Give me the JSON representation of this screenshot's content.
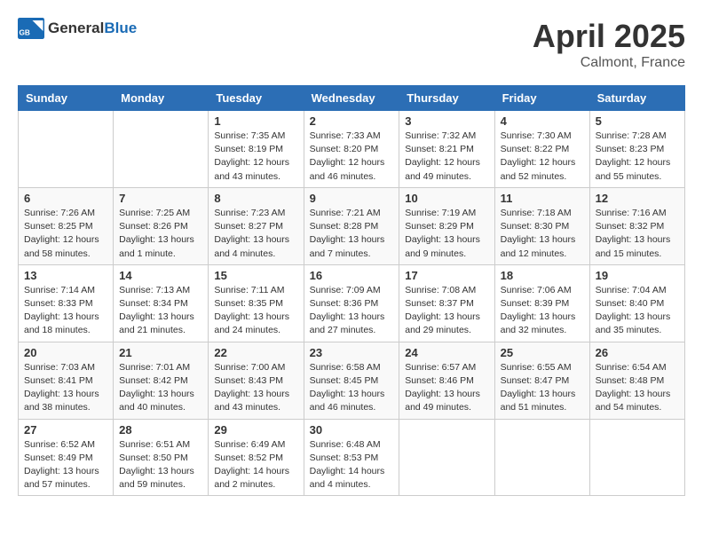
{
  "header": {
    "logo_general": "General",
    "logo_blue": "Blue",
    "title": "April 2025",
    "location": "Calmont, France"
  },
  "days_of_week": [
    "Sunday",
    "Monday",
    "Tuesday",
    "Wednesday",
    "Thursday",
    "Friday",
    "Saturday"
  ],
  "weeks": [
    [
      {
        "day": "",
        "info": ""
      },
      {
        "day": "",
        "info": ""
      },
      {
        "day": "1",
        "info": "Sunrise: 7:35 AM\nSunset: 8:19 PM\nDaylight: 12 hours and 43 minutes."
      },
      {
        "day": "2",
        "info": "Sunrise: 7:33 AM\nSunset: 8:20 PM\nDaylight: 12 hours and 46 minutes."
      },
      {
        "day": "3",
        "info": "Sunrise: 7:32 AM\nSunset: 8:21 PM\nDaylight: 12 hours and 49 minutes."
      },
      {
        "day": "4",
        "info": "Sunrise: 7:30 AM\nSunset: 8:22 PM\nDaylight: 12 hours and 52 minutes."
      },
      {
        "day": "5",
        "info": "Sunrise: 7:28 AM\nSunset: 8:23 PM\nDaylight: 12 hours and 55 minutes."
      }
    ],
    [
      {
        "day": "6",
        "info": "Sunrise: 7:26 AM\nSunset: 8:25 PM\nDaylight: 12 hours and 58 minutes."
      },
      {
        "day": "7",
        "info": "Sunrise: 7:25 AM\nSunset: 8:26 PM\nDaylight: 13 hours and 1 minute."
      },
      {
        "day": "8",
        "info": "Sunrise: 7:23 AM\nSunset: 8:27 PM\nDaylight: 13 hours and 4 minutes."
      },
      {
        "day": "9",
        "info": "Sunrise: 7:21 AM\nSunset: 8:28 PM\nDaylight: 13 hours and 7 minutes."
      },
      {
        "day": "10",
        "info": "Sunrise: 7:19 AM\nSunset: 8:29 PM\nDaylight: 13 hours and 9 minutes."
      },
      {
        "day": "11",
        "info": "Sunrise: 7:18 AM\nSunset: 8:30 PM\nDaylight: 13 hours and 12 minutes."
      },
      {
        "day": "12",
        "info": "Sunrise: 7:16 AM\nSunset: 8:32 PM\nDaylight: 13 hours and 15 minutes."
      }
    ],
    [
      {
        "day": "13",
        "info": "Sunrise: 7:14 AM\nSunset: 8:33 PM\nDaylight: 13 hours and 18 minutes."
      },
      {
        "day": "14",
        "info": "Sunrise: 7:13 AM\nSunset: 8:34 PM\nDaylight: 13 hours and 21 minutes."
      },
      {
        "day": "15",
        "info": "Sunrise: 7:11 AM\nSunset: 8:35 PM\nDaylight: 13 hours and 24 minutes."
      },
      {
        "day": "16",
        "info": "Sunrise: 7:09 AM\nSunset: 8:36 PM\nDaylight: 13 hours and 27 minutes."
      },
      {
        "day": "17",
        "info": "Sunrise: 7:08 AM\nSunset: 8:37 PM\nDaylight: 13 hours and 29 minutes."
      },
      {
        "day": "18",
        "info": "Sunrise: 7:06 AM\nSunset: 8:39 PM\nDaylight: 13 hours and 32 minutes."
      },
      {
        "day": "19",
        "info": "Sunrise: 7:04 AM\nSunset: 8:40 PM\nDaylight: 13 hours and 35 minutes."
      }
    ],
    [
      {
        "day": "20",
        "info": "Sunrise: 7:03 AM\nSunset: 8:41 PM\nDaylight: 13 hours and 38 minutes."
      },
      {
        "day": "21",
        "info": "Sunrise: 7:01 AM\nSunset: 8:42 PM\nDaylight: 13 hours and 40 minutes."
      },
      {
        "day": "22",
        "info": "Sunrise: 7:00 AM\nSunset: 8:43 PM\nDaylight: 13 hours and 43 minutes."
      },
      {
        "day": "23",
        "info": "Sunrise: 6:58 AM\nSunset: 8:45 PM\nDaylight: 13 hours and 46 minutes."
      },
      {
        "day": "24",
        "info": "Sunrise: 6:57 AM\nSunset: 8:46 PM\nDaylight: 13 hours and 49 minutes."
      },
      {
        "day": "25",
        "info": "Sunrise: 6:55 AM\nSunset: 8:47 PM\nDaylight: 13 hours and 51 minutes."
      },
      {
        "day": "26",
        "info": "Sunrise: 6:54 AM\nSunset: 8:48 PM\nDaylight: 13 hours and 54 minutes."
      }
    ],
    [
      {
        "day": "27",
        "info": "Sunrise: 6:52 AM\nSunset: 8:49 PM\nDaylight: 13 hours and 57 minutes."
      },
      {
        "day": "28",
        "info": "Sunrise: 6:51 AM\nSunset: 8:50 PM\nDaylight: 13 hours and 59 minutes."
      },
      {
        "day": "29",
        "info": "Sunrise: 6:49 AM\nSunset: 8:52 PM\nDaylight: 14 hours and 2 minutes."
      },
      {
        "day": "30",
        "info": "Sunrise: 6:48 AM\nSunset: 8:53 PM\nDaylight: 14 hours and 4 minutes."
      },
      {
        "day": "",
        "info": ""
      },
      {
        "day": "",
        "info": ""
      },
      {
        "day": "",
        "info": ""
      }
    ]
  ]
}
